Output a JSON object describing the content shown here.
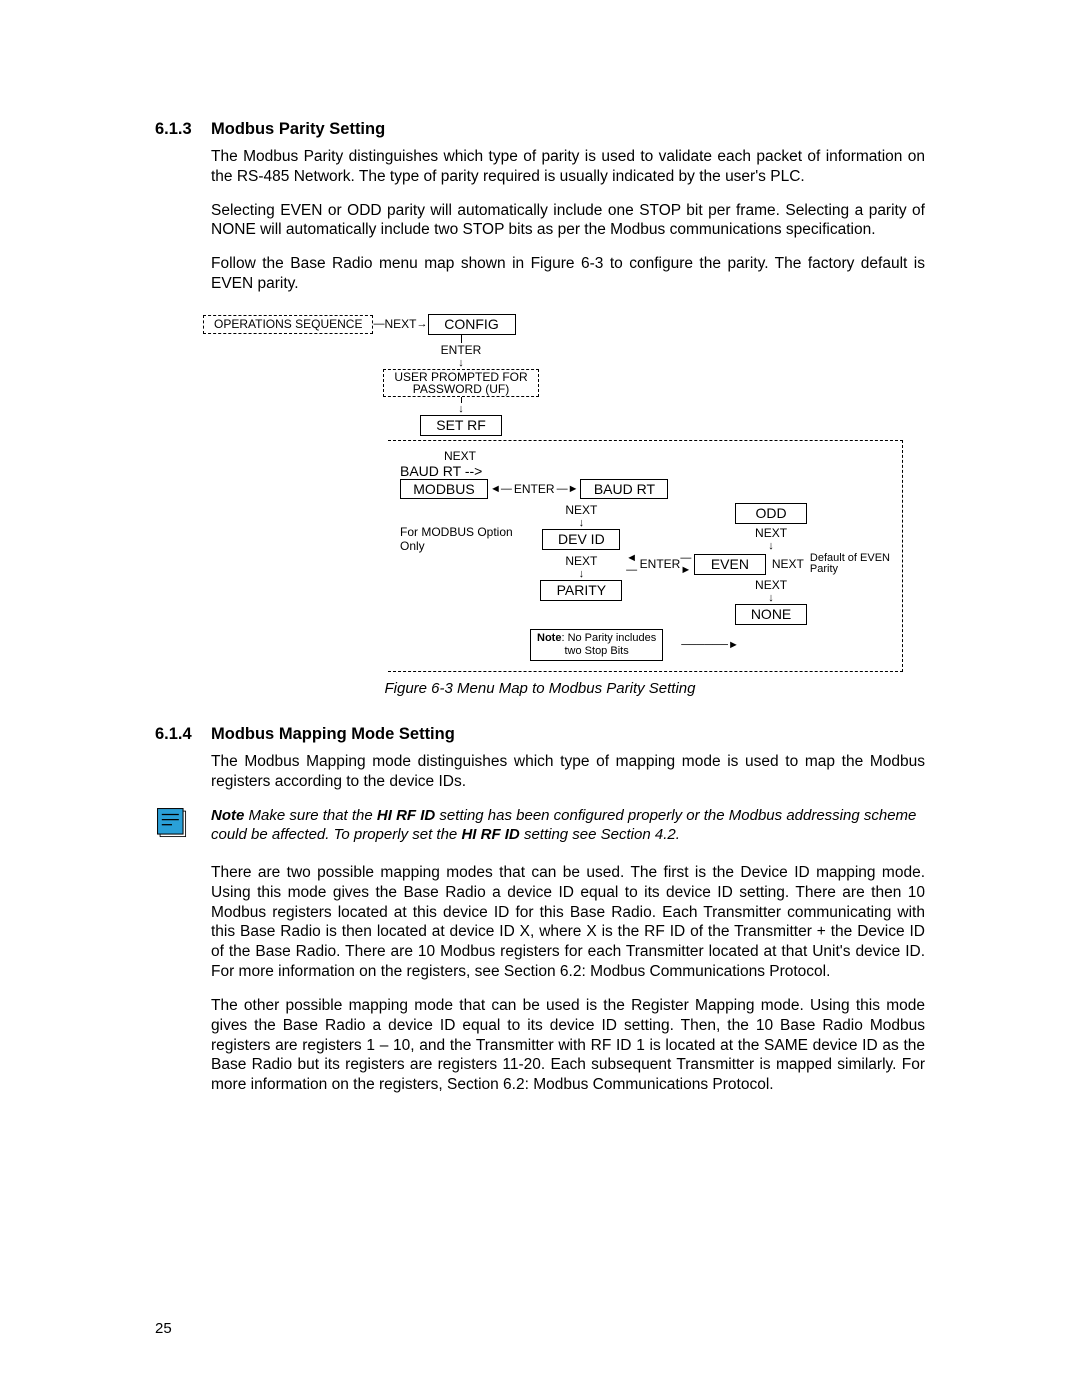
{
  "section1": {
    "number": "6.1.3",
    "title": "Modbus Parity Setting",
    "p1": "The Modbus Parity distinguishes which type of parity is used to validate each packet of information on the RS-485 Network. The type of parity required is usually indicated by the user's PLC.",
    "p2": "Selecting EVEN or ODD parity will automatically include one STOP bit per frame. Selecting a parity of NONE will automatically include two STOP bits as per the Modbus communications specification.",
    "p3": "Follow the Base Radio menu map shown in Figure 6-3 to configure the parity. The factory default is EVEN parity.",
    "figure_caption": "Figure 6-3 Menu Map to Modbus Parity Setting"
  },
  "diagram": {
    "ops_seq": "OPERATIONS SEQUENCE",
    "next": "NEXT",
    "enter": "ENTER",
    "config": "CONFIG",
    "pw": "USER PROMPTED FOR\nPASSWORD (UF)",
    "set_rf": "SET RF",
    "modbus": "MODBUS",
    "baud_rt": "BAUD RT",
    "modbus_opt": "For MODBUS Option Only",
    "dev_id": "DEV ID",
    "parity": "PARITY",
    "odd": "ODD",
    "even": "EVEN",
    "none": "NONE",
    "default_even": "Default of EVEN\nParity",
    "note_bold": "Note",
    "note_rest": ": No Parity includes\ntwo Stop Bits"
  },
  "section2": {
    "number": "6.1.4",
    "title": "Modbus Mapping Mode Setting",
    "p1": "The Modbus Mapping mode distinguishes which type of mapping mode is used to map the Modbus registers according to the device IDs.",
    "note_bold1": "Note",
    "note_text1": " Make sure that the ",
    "note_bold2": "HI RF ID",
    "note_text2": " setting has been configured properly or the Modbus addressing scheme could be affected. To properly set the ",
    "note_bold3": "HI RF ID",
    "note_text3": " setting see Section 4.2.",
    "p2": "There are two possible mapping modes that can be used. The first is the Device ID mapping mode. Using this mode gives the Base Radio a device ID equal to its device ID setting. There are then 10 Modbus registers located at this device ID for this Base Radio. Each Transmitter communicating with this Base Radio is then located at device ID X, where X is the RF ID of the Transmitter + the Device ID of the Base Radio. There are 10 Modbus registers for each Transmitter located at that Unit's device ID. For more information on the registers, see Section 6.2: Modbus Communications Protocol.",
    "p3": "The other possible mapping mode that can be used is the Register Mapping mode. Using this mode gives the Base Radio a device ID equal to its device ID setting. Then, the 10 Base Radio Modbus registers are registers 1 – 10, and the Transmitter with RF ID 1 is located at the SAME device ID as the Base Radio but its registers are registers 11-20. Each subsequent Transmitter is mapped similarly. For more information on the registers, Section 6.2: Modbus Communications Protocol."
  },
  "page_number": "25"
}
